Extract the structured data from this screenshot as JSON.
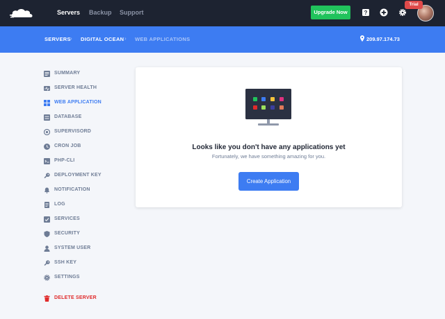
{
  "header": {
    "nav": [
      {
        "label": "Servers",
        "active": true
      },
      {
        "label": "Backup",
        "active": false
      },
      {
        "label": "Support",
        "active": false
      }
    ],
    "upgrade_label": "Upgrade Now",
    "trial_label": "Trial",
    "icons": [
      "help-icon",
      "add-icon",
      "gear-icon"
    ]
  },
  "breadcrumb": {
    "items": [
      "SERVERS",
      "DIGITAL OCEAN",
      "WEB APPLICATIONS"
    ],
    "separator": "›",
    "ip": "209.97.174.73"
  },
  "sidebar": {
    "items": [
      {
        "label": "SUMMARY",
        "icon": "summary-icon"
      },
      {
        "label": "SERVER HEALTH",
        "icon": "server-health-icon"
      },
      {
        "label": "WEB APPLICATION",
        "icon": "web-application-icon",
        "active": true
      },
      {
        "label": "DATABASE",
        "icon": "database-icon"
      },
      {
        "label": "SUPERVISORD",
        "icon": "supervisord-icon"
      },
      {
        "label": "CRON JOB",
        "icon": "cron-job-icon"
      },
      {
        "label": "PHP-CLI",
        "icon": "php-cli-icon"
      },
      {
        "label": "DEPLOYMENT KEY",
        "icon": "key-icon"
      },
      {
        "label": "NOTIFICATION",
        "icon": "notification-icon"
      },
      {
        "label": "LOG",
        "icon": "log-icon"
      },
      {
        "label": "SERVICES",
        "icon": "services-icon"
      },
      {
        "label": "SECURITY",
        "icon": "shield-icon"
      },
      {
        "label": "SYSTEM USER",
        "icon": "user-icon"
      },
      {
        "label": "SSH KEY",
        "icon": "key-icon"
      },
      {
        "label": "SETTINGS",
        "icon": "gear-icon"
      }
    ],
    "delete_label": "DELETE SERVER"
  },
  "main": {
    "empty_title": "Looks like you don't have any applications yet",
    "empty_subtitle": "Fortunately, we have something amazing for you.",
    "create_label": "Create Application"
  },
  "colors": {
    "topbar": "#1d2331",
    "accent": "#3d7cf2",
    "upgrade": "#21c35c",
    "danger": "#e02b2b",
    "sidebar_text": "#6e7c95"
  }
}
